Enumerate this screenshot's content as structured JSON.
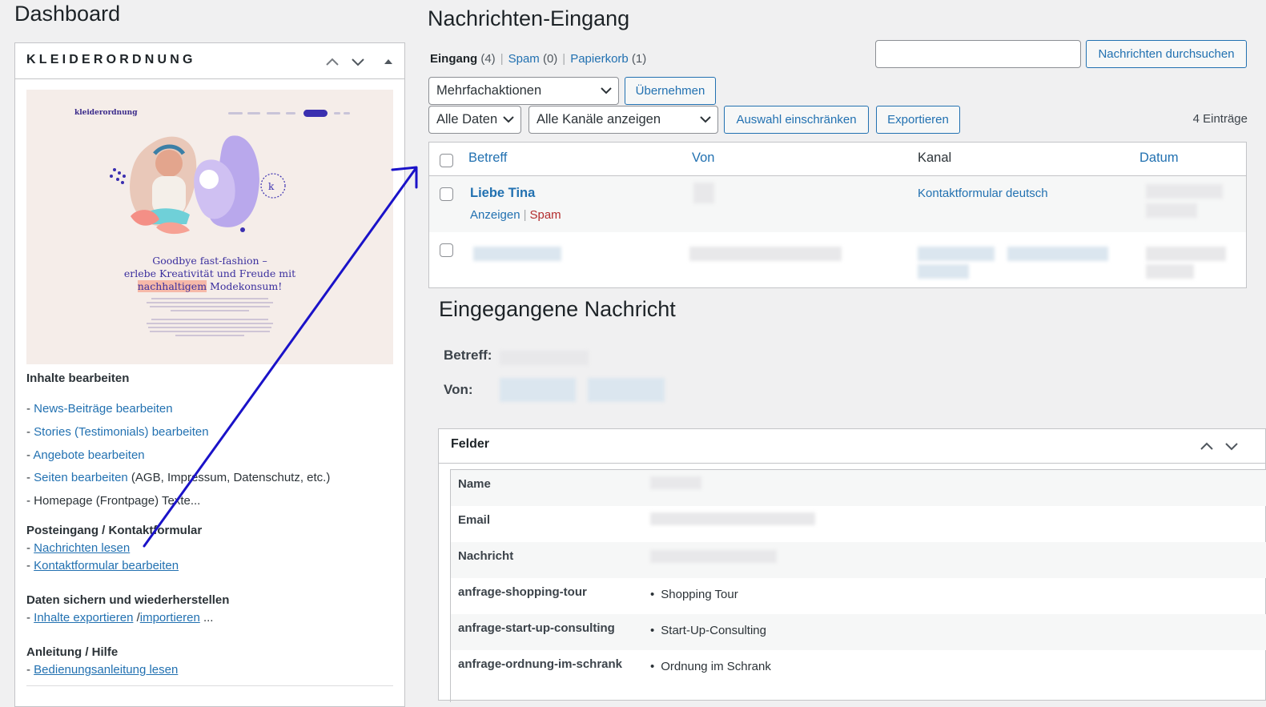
{
  "dashboard": {
    "title": "Dashboard",
    "widget": {
      "title": "KLEIDERORDNUNG",
      "preview": {
        "logo": "kleiderordnung",
        "headline_1": "Goodbye fast-fashion –",
        "headline_2": "erlebe Kreativität und Freude mit",
        "headline_3_mark": "nachhaltigem",
        "headline_3_rest": " Modekonsum!"
      },
      "sections": {
        "inhalte": "Inhalte bearbeiten",
        "news": "News-Beiträge bearbeiten",
        "stories": "Stories (Testimonials) bearbeiten",
        "angebote": "Angebote bearbeiten",
        "seiten": "Seiten bearbeiten",
        "seiten_note": " (AGB, Impressum, Datenschutz, etc.)",
        "homepage": "- Homepage (Frontpage) Texte...",
        "posteingang": "Posteingang / Kontaktformular",
        "nachrichten": "Nachrichten lesen",
        "kontaktformular": "Kontaktformular bearbeiten",
        "daten": "Daten sichern und wiederherstellen",
        "exportieren": "Inhalte exportieren",
        "importieren": "importieren",
        "dots": " ...",
        "anleitung": "Anleitung / Hilfe",
        "bedienung": "Bedienungsanleitung lesen"
      }
    }
  },
  "inbox": {
    "title": "Nachrichten-Eingang",
    "filters": [
      {
        "label": "Eingang",
        "count": "(4)"
      },
      {
        "label": "Spam",
        "count": "(0)"
      },
      {
        "label": "Papierkorb",
        "count": "(1)"
      }
    ],
    "search_button": "Nachrichten durchsuchen",
    "bulk_select": "Mehrfachaktionen",
    "apply_button": "Übernehmen",
    "date_select": "Alle Daten",
    "channel_select": "Alle Kanäle anzeigen",
    "filter_button": "Auswahl einschränken",
    "export_button": "Exportieren",
    "count_label": "4 Einträge",
    "columns": [
      "Betreff",
      "Von",
      "Kanal",
      "Datum"
    ],
    "row1": {
      "subject": "Liebe Tina",
      "channel": "Kontaktformular deutsch",
      "action_view": "Anzeigen",
      "action_spam": "Spam"
    }
  },
  "message": {
    "title": "Eingegangene Nachricht",
    "subject_label": "Betreff:",
    "from_label": "Von:",
    "fields_box": {
      "title": "Felder",
      "rows": [
        {
          "key": "Name",
          "value": ""
        },
        {
          "key": "Email",
          "value": ""
        },
        {
          "key": "Nachricht",
          "value": ""
        },
        {
          "key": "anfrage-shopping-tour",
          "value": "Shopping Tour"
        },
        {
          "key": "anfrage-start-up-consulting",
          "value": "Start-Up-Consulting"
        },
        {
          "key": "anfrage-ordnung-im-schrank",
          "value": "Ordnung im Schrank"
        }
      ]
    }
  },
  "colors": {
    "link": "#2271b1",
    "spam": "#b32d2e",
    "arrow": "#1a12c8"
  }
}
